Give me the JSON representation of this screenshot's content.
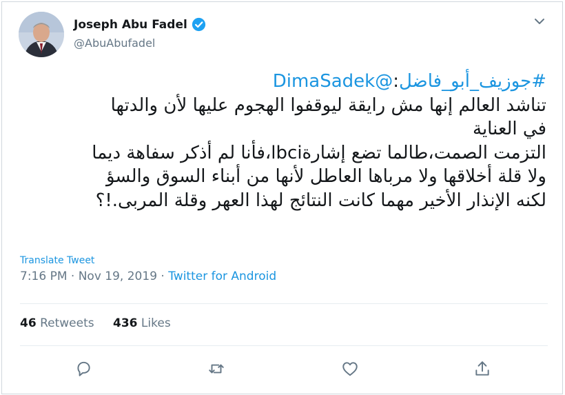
{
  "author": {
    "name": "Joseph Abu Fadel",
    "handle": "@AbuAbufadel",
    "verified": true
  },
  "tweet": {
    "hashtag": "#جوزيف_أبو_فاضل",
    "mention": "@DimaSadek",
    "mention_sep": ":",
    "lines": [
      "تناشد العالم إنها مش رايقة ليوقفوا الهجوم عليها لأن والدتها",
      "في العناية",
      "التزمت الصمت،طالما تضع إشارةlbci،فأنا لم أذكر سفاهة ديما",
      "ولا قلة أخلاقها ولا مرباها العاطل  لأنها من أبناء السوق والسؤ",
      "لكنه الإنذار الأخير مهما كانت النتائج لهذا العهر وقلة المربى.!؟"
    ]
  },
  "translate_label": "Translate Tweet",
  "meta": {
    "time": "7:16 PM",
    "sep1": " · ",
    "date": "Nov 19, 2019",
    "sep2": " · ",
    "source": "Twitter for Android"
  },
  "stats": {
    "retweets_count": "46",
    "retweets_label": "Retweets",
    "likes_count": "436",
    "likes_label": "Likes"
  },
  "colors": {
    "link": "#1b95e0",
    "secondary": "#657786",
    "divider": "#e6ecf0"
  },
  "icons": {
    "reply": "reply-icon",
    "retweet": "retweet-icon",
    "like": "heart-icon",
    "share": "share-icon",
    "more": "chevron-down-icon",
    "verified": "verified-badge-icon"
  }
}
